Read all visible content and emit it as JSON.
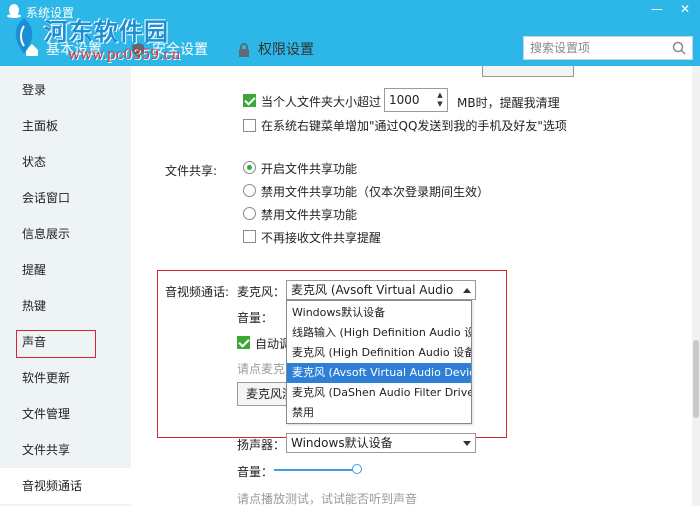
{
  "window": {
    "title": "系统设置",
    "minimize": "—",
    "close": "✕"
  },
  "watermark": {
    "name": "河东软件园",
    "url": "www.pc0359.cn"
  },
  "tabs": [
    {
      "label": "基本设置",
      "icon": "home-icon"
    },
    {
      "label": "安全设置",
      "icon": "shield-icon"
    },
    {
      "label": "权限设置",
      "icon": "lock-icon"
    }
  ],
  "search": {
    "placeholder": "搜索设置项"
  },
  "sidebar": {
    "items": [
      {
        "label": "登录"
      },
      {
        "label": "主面板"
      },
      {
        "label": "状态"
      },
      {
        "label": "会话窗口"
      },
      {
        "label": "信息展示"
      },
      {
        "label": "提醒"
      },
      {
        "label": "热键"
      },
      {
        "label": "声音"
      },
      {
        "label": "软件更新"
      },
      {
        "label": "文件管理"
      },
      {
        "label": "文件共享"
      },
      {
        "label": "音视频通话"
      }
    ],
    "active": "音视频通话"
  },
  "file_mgmt": {
    "size_limit_prefix": "当个人文件夹大小超过",
    "size_limit_value": "1000",
    "size_limit_suffix": "MB时，提醒我清理",
    "context_menu": "在系统右键菜单增加\"通过QQ发送到我的手机及好友\"选项"
  },
  "file_share": {
    "label": "文件共享:",
    "options": [
      "开启文件共享功能",
      "禁用文件共享功能（仅本次登录期间生效）",
      "禁用文件共享功能"
    ],
    "selected_index": 0,
    "no_notify": "不再接收文件共享提醒"
  },
  "av_call": {
    "label": "音视频通话:",
    "mic_label": "麦克风：",
    "mic_value": "麦克风 (Avsoft Virtual Audio De...",
    "volume_label": "音量：",
    "auto_adjust": "自动调",
    "mic_hint": "请点麦克",
    "mic_test_button": "麦克风测",
    "mic_options": [
      "Windows默认设备",
      "线路输入 (High Definition Audio 设备",
      "麦克风 (High Definition Audio 设备)",
      "麦克风 (Avsoft Virtual Audio Device)",
      "麦克风 (DaShen Audio Filter Driver (",
      "禁用"
    ],
    "mic_selected_index": 3,
    "speaker_label": "扬声器：",
    "speaker_value": "Windows默认设备",
    "speaker_volume_label": "音量：",
    "speaker_volume": 0.95,
    "speaker_hint": "请点播放测试，试试能否听到声音"
  },
  "colors": {
    "header": "#2db7e8",
    "accent_green": "#3aa93a",
    "highlight": "#d9232d",
    "selection": "#2f7fd6"
  }
}
